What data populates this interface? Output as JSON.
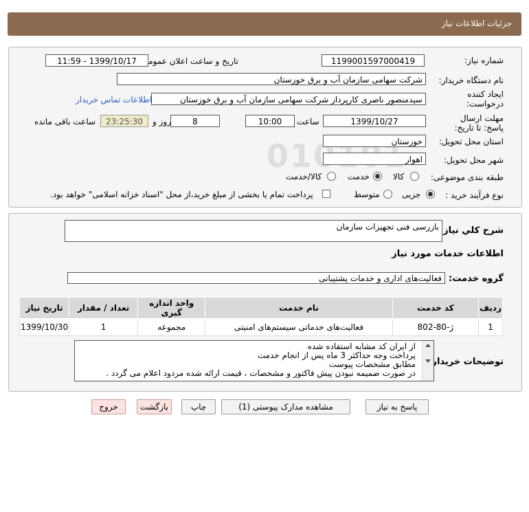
{
  "window_title": "جزئیات اطلاعات نیاز",
  "fields": {
    "need_number_label": "شماره نیاز:",
    "need_number": "1199001597000419",
    "announce_label": "تاریخ و ساعت اعلان عمومی:",
    "announce_value": "1399/10/17 - 11:59",
    "buyer_org_label": "نام دستگاه خریدار:",
    "buyer_org": "شرکت سهامی سازمان آب و برق خوزستان",
    "creator_label": "ایجاد کننده درخواست:",
    "creator": "سیدمنصور ناصری کارپرداز شرکت سهامی سازمان آب و برق خوزستان",
    "contact_link": "اطلاعات تماس خریدار",
    "deadline_label": "مهلت ارسال پاسخ: تا تاریخ:",
    "deadline_date": "1399/10/27",
    "time_label": "ساعت",
    "deadline_time": "10:00",
    "days_value": "8",
    "days_label": "روز و",
    "remaining_time": "23:25:30",
    "remaining_label": "ساعت باقی مانده",
    "province_label": "استان محل تحویل:",
    "province": "خوزستان",
    "city_label": "شهر محل تحویل:",
    "city": "اهواز",
    "category_label": "طبقه بندی موضوعی:",
    "category_options": [
      "کالا",
      "خدمت",
      "کالا/خدمت"
    ],
    "category_selected": "خدمت",
    "process_label": "نوع فرآیند خرید :",
    "process_options": [
      "جزیی",
      "متوسط"
    ],
    "process_selected": "جزیی",
    "payment_note": "پرداخت تمام یا بخشی از مبلغ خرید،از محل \"اسناد خزانه اسلامی\" خواهد بود."
  },
  "description": {
    "label": "شرح کلي نياز:",
    "value": "بازرسی فنی تجهیزات سازمان"
  },
  "services": {
    "section_title": "اطلاعات خدمات مورد نیاز",
    "group_label": "گروه خدمت:",
    "group_value": "فعالیت‌های اداری و خدمات پشتیبانی",
    "columns": [
      "ردیف",
      "کد خدمت",
      "نام خدمت",
      "واحد اندازه گیری",
      "تعداد / مقدار",
      "تاریخ نیاز"
    ],
    "rows": [
      {
        "row": "1",
        "code": "ژ-80-802",
        "name": "فعالیت‌های خدماتی سیستم‌های امنیتی",
        "unit": "مجموعه",
        "qty": "1",
        "date": "1399/10/30"
      }
    ]
  },
  "buyer_notes": {
    "label": "توضیحات خریدار:",
    "lines": [
      "از ایران کد مشابه استفاده شده",
      "پرداخت وجه حداکثر 3  ماه پس از انجام خدمت",
      "مطابق مشخصات پیوست",
      "در صورت ضمیمه نبودن پیش فاکتور و مشخصات ، قیمت ارائه شده مردود اعلام می گردد ."
    ]
  },
  "buttons": {
    "reply": "پاسخ به نیاز",
    "attachments": "مشاهده مدارک پیوستی (1)",
    "print": "چاپ",
    "back": "بازگشت",
    "exit": "خروج"
  }
}
